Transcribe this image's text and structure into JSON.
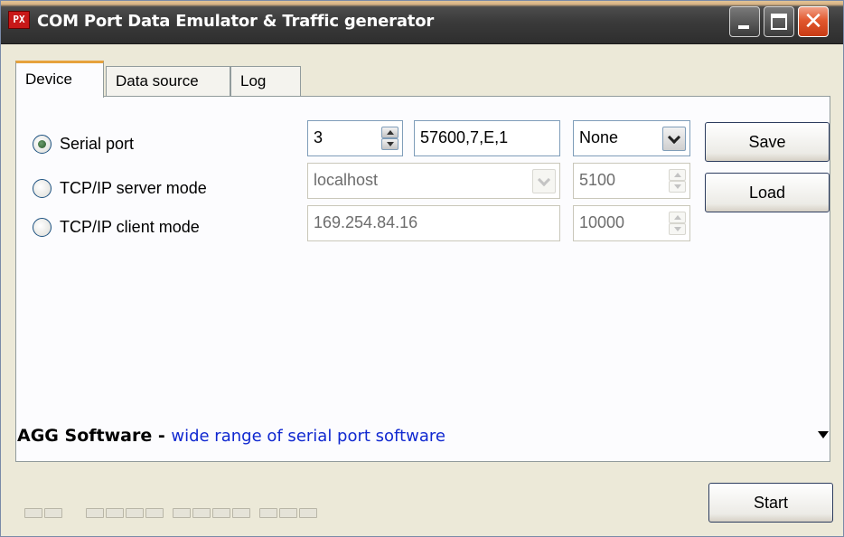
{
  "window": {
    "icon_text": "PX",
    "title": "COM Port Data Emulator & Traffic generator"
  },
  "tabs": [
    {
      "label": "Device",
      "active": true
    },
    {
      "label": "Data source",
      "active": false
    },
    {
      "label": "Log",
      "active": false
    }
  ],
  "modes": [
    {
      "label": "Serial port",
      "selected": true
    },
    {
      "label": "TCP/IP server mode",
      "selected": false
    },
    {
      "label": "TCP/IP client mode",
      "selected": false
    }
  ],
  "serial": {
    "port": "3",
    "params": "57600,7,E,1",
    "flow_control": "None"
  },
  "server": {
    "host": "localhost",
    "port": "5100"
  },
  "client": {
    "host": "169.254.84.16",
    "port": "10000"
  },
  "buttons": {
    "save": "Save",
    "load": "Load",
    "start": "Start"
  },
  "footer": {
    "brand": "AGG Software",
    "separator": " - ",
    "link": "wide range of serial port software"
  },
  "colors": {
    "link": "#1028d0",
    "active_tab_accent": "#e6a23c",
    "close_button": "#e2582f"
  }
}
